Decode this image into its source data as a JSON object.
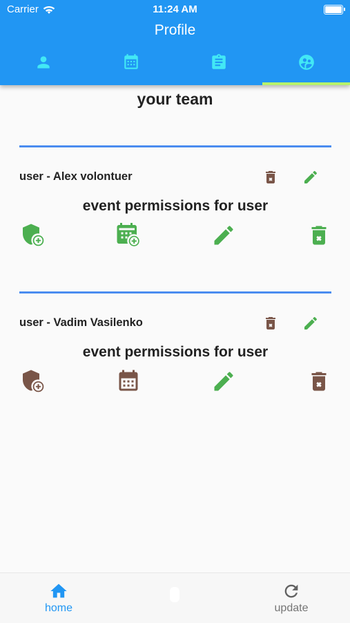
{
  "status_bar": {
    "carrier": "Carrier",
    "time": "11:24 AM"
  },
  "app_bar": {
    "title": "Profile",
    "tabs": [
      {
        "icon": "person-icon",
        "active": false
      },
      {
        "icon": "calendar-icon",
        "active": false
      },
      {
        "icon": "clipboard-icon",
        "active": false
      },
      {
        "icon": "team-icon",
        "active": true
      }
    ]
  },
  "main": {
    "title": "your team",
    "members": [
      {
        "label": "user - Alex volontuer",
        "permissions_title": "event permissions for user"
      },
      {
        "label": "user - Vadim Vasilenko",
        "permissions_title": "event permissions for user"
      }
    ]
  },
  "bottom_nav": {
    "home_label": "home",
    "update_label": "update"
  },
  "colors": {
    "primary": "#2196f3",
    "tab_indicator": "#b7f26b",
    "divider": "#4a8cf0",
    "green": "#4caf50",
    "brown": "#795548",
    "tab_icon": "#42e8f5"
  }
}
